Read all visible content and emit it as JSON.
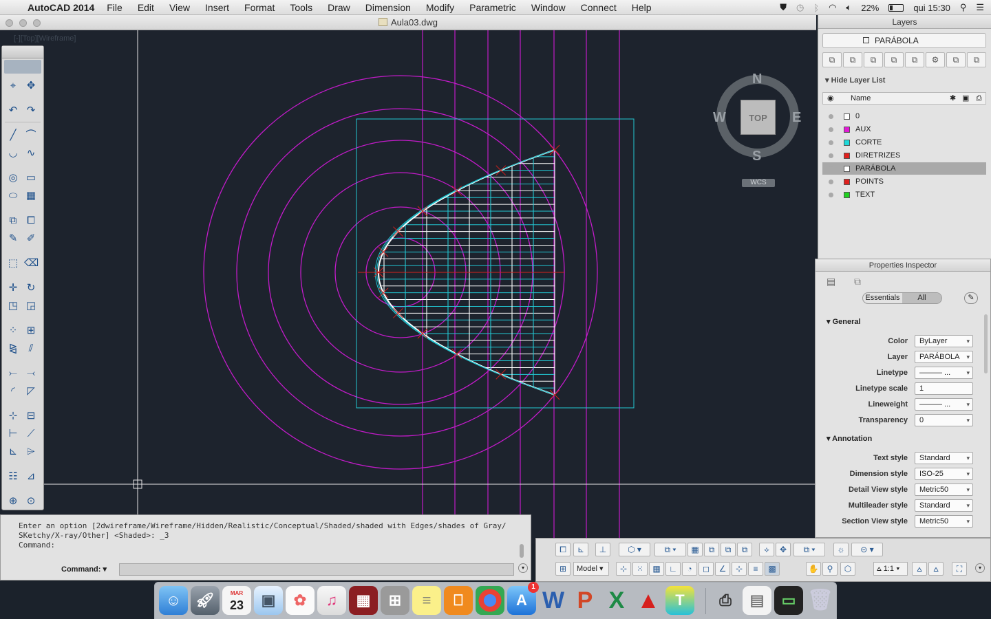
{
  "menubar": {
    "app_name": "AutoCAD 2014",
    "items": [
      "File",
      "Edit",
      "View",
      "Insert",
      "Format",
      "Tools",
      "Draw",
      "Dimension",
      "Modify",
      "Parametric",
      "Window",
      "Connect",
      "Help"
    ],
    "battery": "22%",
    "clock": "qui 15:30"
  },
  "window": {
    "title": "Aula03.dwg",
    "viewport_label": "[-][Top][Wireframe]"
  },
  "viewcube": {
    "top_label": "TOP",
    "north": "N",
    "south": "S",
    "east": "E",
    "west": "W",
    "wcs_label": "WCS"
  },
  "layers_panel": {
    "title": "Layers",
    "current_layer": "PARÁBOLA",
    "hide_toggle": "Hide Layer List",
    "column_name": "Name",
    "layers": [
      {
        "name": "0",
        "color": "#ffffff"
      },
      {
        "name": "AUX",
        "color": "#e21ad6"
      },
      {
        "name": "CORTE",
        "color": "#1fd9d9"
      },
      {
        "name": "DIRETRIZES",
        "color": "#e0201d"
      },
      {
        "name": "PARÁBOLA",
        "color": "#ffffff",
        "active": true
      },
      {
        "name": "POINTS",
        "color": "#e0201d"
      },
      {
        "name": "TEXT",
        "color": "#1fd11f"
      }
    ]
  },
  "properties": {
    "title": "Properties Inspector",
    "tab_essentials": "Essentials",
    "tab_all": "All",
    "section_general": "General",
    "section_annotation": "Annotation",
    "general": [
      {
        "label": "Color",
        "value": "ByLayer"
      },
      {
        "label": "Layer",
        "value": "PARÁBOLA"
      },
      {
        "label": "Linetype",
        "value": "——— ..."
      },
      {
        "label": "Linetype scale",
        "value": "1"
      },
      {
        "label": "Lineweight",
        "value": "——— ..."
      },
      {
        "label": "Transparency",
        "value": "0"
      }
    ],
    "annotation": [
      {
        "label": "Text style",
        "value": "Standard"
      },
      {
        "label": "Dimension style",
        "value": "ISO-25"
      },
      {
        "label": "Detail View style",
        "value": "Metric50"
      },
      {
        "label": "Multileader style",
        "value": "Standard"
      },
      {
        "label": "Section View style",
        "value": "Metric50"
      }
    ]
  },
  "command": {
    "history": "Enter an option [2dwireframe/Wireframe/Hidden/Realistic/Conceptual/Shaded/shaded with Edges/shades of Gray/\nSKetchy/X-ray/Other] <Shaded>: _3\nCommand:",
    "prompt": "Command:"
  },
  "statusbar": {
    "model_tab": "Model",
    "annotation_scale": "1:1"
  },
  "colors": {
    "canvas": "#1d232d",
    "magenta": "#c21bc9",
    "cyan": "#22c8d4",
    "red": "#d6201d"
  },
  "dock_apps": [
    "Finder",
    "Launchpad",
    "Calendar",
    "Preview",
    "Photos",
    "iTunes",
    "Photo Booth",
    "Calculator",
    "Notes",
    "iBooks",
    "Chrome",
    "App Store",
    "Word",
    "PowerPoint",
    "Excel",
    "AutoCAD",
    "Teamviewer",
    "Scanner",
    "Trash"
  ],
  "dock_calendar": {
    "month": "MAR",
    "day": "23"
  },
  "dock_badge": "1"
}
